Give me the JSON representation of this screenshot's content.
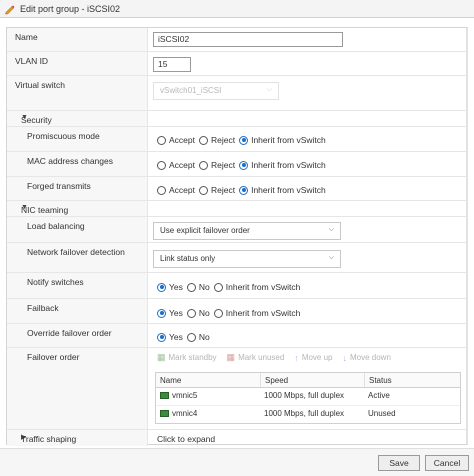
{
  "window": {
    "title": "Edit port group - iSCSI02"
  },
  "fields": {
    "name": {
      "label": "Name",
      "value": "iSCSI02"
    },
    "vlan": {
      "label": "VLAN ID",
      "value": "15"
    },
    "vswitch": {
      "label": "Virtual switch",
      "value": "vSwitch01_iSCSI"
    }
  },
  "security": {
    "section_label": "Security",
    "rows": [
      {
        "label": "Promiscuous mode",
        "selected": 2
      },
      {
        "label": "MAC address changes",
        "selected": 2
      },
      {
        "label": "Forged transmits",
        "selected": 2
      }
    ],
    "options": [
      "Accept",
      "Reject",
      "Inherit from vSwitch"
    ]
  },
  "nic_teaming": {
    "section_label": "NIC teaming",
    "load_balancing": {
      "label": "Load balancing",
      "value": "Use explicit failover order"
    },
    "failover_detection": {
      "label": "Network failover detection",
      "value": "Link status only"
    },
    "notify_switches": {
      "label": "Notify switches",
      "options": [
        "Yes",
        "No",
        "Inherit from vSwitch"
      ],
      "selected": 0
    },
    "failback": {
      "label": "Failback",
      "options": [
        "Yes",
        "No",
        "Inherit from vSwitch"
      ],
      "selected": 0
    },
    "override": {
      "label": "Override failover order",
      "options": [
        "Yes",
        "No"
      ],
      "selected": 0
    },
    "failover_order": {
      "label": "Failover order",
      "toolbar": [
        "Mark standby",
        "Mark unused",
        "Move up",
        "Move down"
      ],
      "columns": [
        "Name",
        "Speed",
        "Status"
      ],
      "rows": [
        {
          "name": "vmnic5",
          "speed": "1000 Mbps, full duplex",
          "status": "Active"
        },
        {
          "name": "vmnic4",
          "speed": "1000 Mbps, full duplex",
          "status": "Unused"
        }
      ]
    }
  },
  "traffic_shaping": {
    "section_label": "Traffic shaping",
    "value": "Click to expand"
  },
  "buttons": {
    "save": "Save",
    "cancel": "Cancel"
  },
  "colors": {
    "accent": "#1a6fc9",
    "nic": "#3d8b3d"
  }
}
